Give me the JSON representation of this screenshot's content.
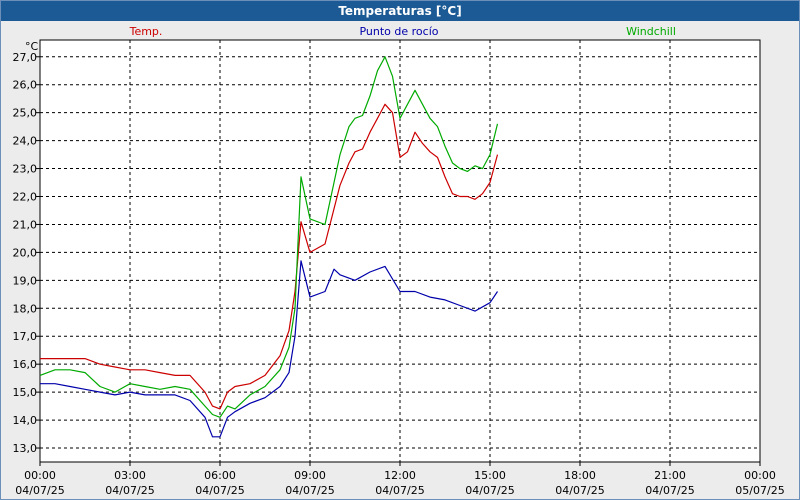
{
  "window": {
    "title": "Temperaturas [°C]"
  },
  "colors": {
    "titlebar": "#1c5a96",
    "temp": "#cc0000",
    "dewpoint": "#0000aa",
    "windchill": "#00aa00",
    "grid": "#000000"
  },
  "chart_data": {
    "type": "line",
    "title": "Temperaturas [°C]",
    "ylabel": "°C",
    "ylim": [
      12.5,
      27.6
    ],
    "y_ticks": [
      "13,0",
      "14,0",
      "15,0",
      "16,0",
      "17,0",
      "18,0",
      "19,0",
      "20,0",
      "21,0",
      "22,0",
      "23,0",
      "24,0",
      "25,0",
      "26,0",
      "27,0"
    ],
    "y_tick_values": [
      13,
      14,
      15,
      16,
      17,
      18,
      19,
      20,
      21,
      22,
      23,
      24,
      25,
      26,
      27
    ],
    "xlim": [
      0,
      24
    ],
    "x_ticks": [
      {
        "time": "00:00",
        "date": "04/07/25",
        "h": 0
      },
      {
        "time": "03:00",
        "date": "04/07/25",
        "h": 3
      },
      {
        "time": "06:00",
        "date": "04/07/25",
        "h": 6
      },
      {
        "time": "09:00",
        "date": "04/07/25",
        "h": 9
      },
      {
        "time": "12:00",
        "date": "04/07/25",
        "h": 12
      },
      {
        "time": "15:00",
        "date": "04/07/25",
        "h": 15
      },
      {
        "time": "18:00",
        "date": "04/07/25",
        "h": 18
      },
      {
        "time": "21:00",
        "date": "04/07/25",
        "h": 21
      },
      {
        "time": "00:00",
        "date": "05/07/25",
        "h": 24
      }
    ],
    "grid": true,
    "legend_position": "top",
    "series": [
      {
        "name": "Temp.",
        "color": "#cc0000",
        "points": [
          [
            0,
            16.2
          ],
          [
            0.5,
            16.2
          ],
          [
            1,
            16.2
          ],
          [
            1.5,
            16.2
          ],
          [
            2,
            16.0
          ],
          [
            2.5,
            15.9
          ],
          [
            3,
            15.8
          ],
          [
            3.5,
            15.8
          ],
          [
            4,
            15.7
          ],
          [
            4.5,
            15.6
          ],
          [
            5,
            15.6
          ],
          [
            5.5,
            15.0
          ],
          [
            5.75,
            14.5
          ],
          [
            6,
            14.4
          ],
          [
            6.25,
            15.0
          ],
          [
            6.5,
            15.2
          ],
          [
            7,
            15.3
          ],
          [
            7.5,
            15.6
          ],
          [
            8,
            16.3
          ],
          [
            8.3,
            17.2
          ],
          [
            8.5,
            18.6
          ],
          [
            8.7,
            21.1
          ],
          [
            9,
            20.0
          ],
          [
            9.5,
            20.3
          ],
          [
            10,
            22.4
          ],
          [
            10.3,
            23.2
          ],
          [
            10.5,
            23.6
          ],
          [
            10.75,
            23.7
          ],
          [
            11,
            24.3
          ],
          [
            11.25,
            24.8
          ],
          [
            11.5,
            25.3
          ],
          [
            11.75,
            25.0
          ],
          [
            12,
            23.4
          ],
          [
            12.25,
            23.6
          ],
          [
            12.5,
            24.3
          ],
          [
            12.75,
            23.9
          ],
          [
            13,
            23.6
          ],
          [
            13.25,
            23.4
          ],
          [
            13.5,
            22.7
          ],
          [
            13.75,
            22.1
          ],
          [
            14,
            22.0
          ],
          [
            14.25,
            22.0
          ],
          [
            14.5,
            21.9
          ],
          [
            14.75,
            22.1
          ],
          [
            15,
            22.5
          ],
          [
            15.25,
            23.5
          ]
        ]
      },
      {
        "name": "Punto de rocío",
        "color": "#0000aa",
        "points": [
          [
            0,
            15.3
          ],
          [
            0.5,
            15.3
          ],
          [
            1,
            15.2
          ],
          [
            1.5,
            15.1
          ],
          [
            2,
            15.0
          ],
          [
            2.5,
            14.9
          ],
          [
            3,
            15.0
          ],
          [
            3.5,
            14.9
          ],
          [
            4,
            14.9
          ],
          [
            4.5,
            14.9
          ],
          [
            5,
            14.7
          ],
          [
            5.5,
            14.1
          ],
          [
            5.75,
            13.4
          ],
          [
            6,
            13.4
          ],
          [
            6.25,
            14.1
          ],
          [
            6.5,
            14.3
          ],
          [
            7,
            14.6
          ],
          [
            7.5,
            14.8
          ],
          [
            8,
            15.2
          ],
          [
            8.3,
            15.7
          ],
          [
            8.5,
            17.0
          ],
          [
            8.7,
            19.7
          ],
          [
            9,
            18.4
          ],
          [
            9.5,
            18.6
          ],
          [
            9.8,
            19.4
          ],
          [
            10,
            19.2
          ],
          [
            10.5,
            19.0
          ],
          [
            11,
            19.3
          ],
          [
            11.5,
            19.5
          ],
          [
            12,
            18.6
          ],
          [
            12.5,
            18.6
          ],
          [
            13,
            18.4
          ],
          [
            13.5,
            18.3
          ],
          [
            14,
            18.1
          ],
          [
            14.5,
            17.9
          ],
          [
            15,
            18.2
          ],
          [
            15.25,
            18.6
          ]
        ]
      },
      {
        "name": "Windchill",
        "color": "#00aa00",
        "points": [
          [
            0,
            15.6
          ],
          [
            0.5,
            15.8
          ],
          [
            1,
            15.8
          ],
          [
            1.5,
            15.7
          ],
          [
            2,
            15.2
          ],
          [
            2.5,
            15.0
          ],
          [
            3,
            15.3
          ],
          [
            3.5,
            15.2
          ],
          [
            4,
            15.1
          ],
          [
            4.5,
            15.2
          ],
          [
            5,
            15.1
          ],
          [
            5.5,
            14.5
          ],
          [
            5.75,
            14.2
          ],
          [
            6,
            14.1
          ],
          [
            6.25,
            14.5
          ],
          [
            6.5,
            14.4
          ],
          [
            7,
            14.9
          ],
          [
            7.5,
            15.2
          ],
          [
            8,
            15.8
          ],
          [
            8.3,
            16.6
          ],
          [
            8.5,
            18.0
          ],
          [
            8.7,
            22.7
          ],
          [
            9,
            21.2
          ],
          [
            9.5,
            21.0
          ],
          [
            10,
            23.5
          ],
          [
            10.3,
            24.5
          ],
          [
            10.5,
            24.8
          ],
          [
            10.75,
            24.9
          ],
          [
            11,
            25.6
          ],
          [
            11.25,
            26.5
          ],
          [
            11.5,
            27.0
          ],
          [
            11.75,
            26.3
          ],
          [
            12,
            24.8
          ],
          [
            12.25,
            25.3
          ],
          [
            12.5,
            25.8
          ],
          [
            12.75,
            25.3
          ],
          [
            13,
            24.8
          ],
          [
            13.25,
            24.5
          ],
          [
            13.5,
            23.8
          ],
          [
            13.75,
            23.2
          ],
          [
            14,
            23.0
          ],
          [
            14.25,
            22.9
          ],
          [
            14.5,
            23.1
          ],
          [
            14.75,
            23.0
          ],
          [
            15,
            23.5
          ],
          [
            15.25,
            24.6
          ]
        ]
      }
    ]
  }
}
